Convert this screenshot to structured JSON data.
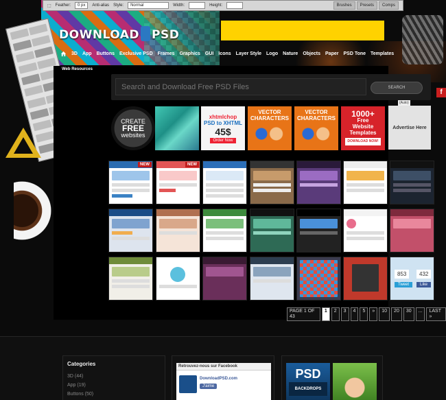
{
  "photoshop_bar": {
    "feather_label": "Feather:",
    "feather_value": "0 px",
    "antialias_label": "Anti-alias",
    "style_label": "Style:",
    "style_value": "Normal",
    "width_label": "Width:",
    "height_label": "Height:",
    "tabs": [
      "Brushes",
      "Presets",
      "Comps"
    ]
  },
  "header": {
    "logo_left": "DOWNLOAD",
    "logo_right": "PSD"
  },
  "nav": {
    "items": [
      "3D",
      "App",
      "Buttons",
      "Exclusive PSD",
      "Frames",
      "Graphics",
      "GUI",
      "Icons",
      "Layer Style",
      "Logo",
      "Nature",
      "Objects",
      "Paper",
      "PSD Tone",
      "Templates"
    ]
  },
  "breadcrumb": "Web Resources",
  "search": {
    "placeholder": "Search and Download Free PSD Files",
    "button": "SEARCH"
  },
  "ads": {
    "create": {
      "line1": "CREATE",
      "line2": "FREE",
      "line3": "websites"
    },
    "xhtml": {
      "brand": "xhtmlchop",
      "line1": "PSD to XHTML",
      "price": "45$",
      "cta": "Order Now"
    },
    "vector1": {
      "line1": "VECTOR",
      "line2": "CHARACTERS"
    },
    "vector2": {
      "line1": "VECTOR",
      "line2": "CHARACTERS"
    },
    "templates": {
      "big": "1000+",
      "line1": "Free",
      "line2": "Website",
      "line3": "Templates",
      "cta": "DOWNLOAD NOW!"
    },
    "side": {
      "tag": "(Auto)",
      "label": "Advertise Here"
    }
  },
  "thumbnails": {
    "new_badge": "NEW",
    "social_counts": [
      "853",
      "432"
    ],
    "social_buttons": [
      "Tweet",
      "Like"
    ]
  },
  "pagination": {
    "info": "PAGE 1 OF 43",
    "pages": [
      "1",
      "2",
      "3",
      "4",
      "5",
      "»",
      "10",
      "20",
      "30",
      "...",
      "LAST »"
    ],
    "current": "1"
  },
  "footer": {
    "categories_title": "Categories",
    "categories": [
      "3D (44)",
      "App (19)",
      "Buttons (50)"
    ],
    "facebook_header": "Retrouvez-nous sur Facebook",
    "facebook_name": "DownloadPSD.com",
    "facebook_like": "J'aime",
    "promo_text": "PSD",
    "promo_sub": "BACKDROPS"
  },
  "colors": {
    "accent_yellow": "#ffd200",
    "brand_blue": "#2b78c2",
    "ad_orange": "#e87417",
    "ad_red": "#d7232a"
  }
}
